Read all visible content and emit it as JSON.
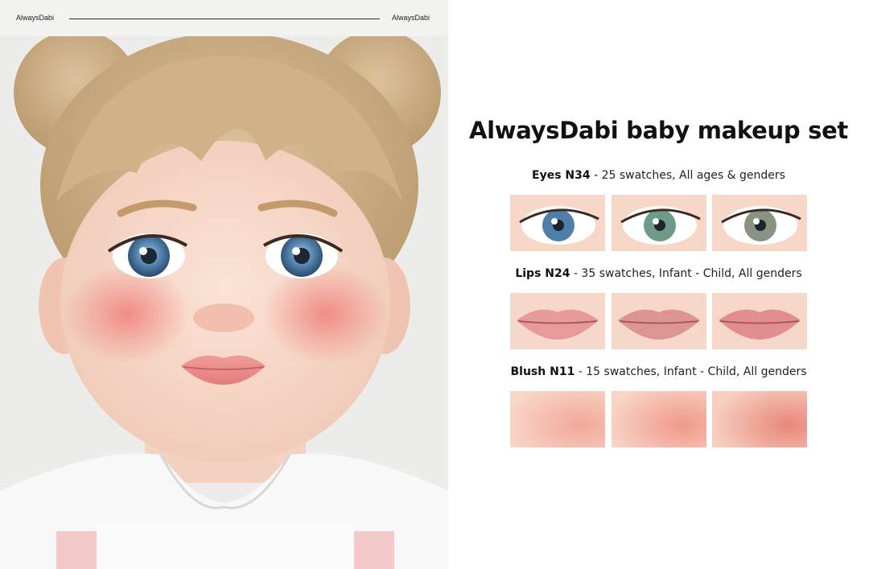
{
  "header": {
    "brand_left": "AlwaysDabi",
    "brand_right": "AlwaysDabi"
  },
  "title": "AlwaysDabi baby makeup set",
  "sections": [
    {
      "name": "Eyes N34",
      "details": " - 25 swatches, All ages & genders",
      "swatch_colors": [
        "#4f7ea8",
        "#6f9a88",
        "#8a9282"
      ]
    },
    {
      "name": "Lips N24",
      "details": " - 35 swatches, Infant - Child, All genders",
      "swatch_colors": [
        "#e89a98",
        "#dc9590",
        "#e28e8e"
      ]
    },
    {
      "name": "Blush N11",
      "details": " - 15 swatches, Infant - Child, All genders",
      "swatch_colors": [
        "#f1a89a",
        "#f0998b",
        "#e9877a"
      ]
    }
  ]
}
